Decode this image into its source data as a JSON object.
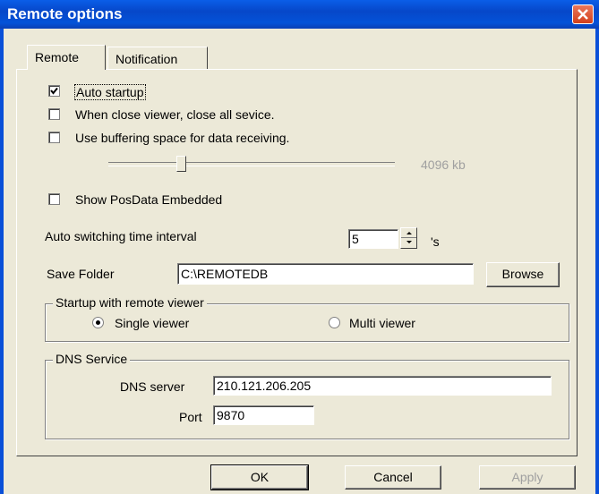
{
  "window": {
    "title": "Remote options"
  },
  "tabs": [
    {
      "label": "Remote"
    },
    {
      "label": "Notification"
    }
  ],
  "options": {
    "auto_startup": {
      "label": "Auto startup",
      "checked": true
    },
    "close_all_service": {
      "label": "When close viewer, close all sevice.",
      "checked": false
    },
    "buffering": {
      "label": "Use buffering space for data receiving.",
      "checked": false
    },
    "buffer_value": "4096 kb",
    "buffer_slider_fraction": 0.27,
    "show_posdata": {
      "label": "Show PosData Embedded",
      "checked": false
    }
  },
  "auto_switch": {
    "label": "Auto switching time interval",
    "value": "5",
    "unit": "'s"
  },
  "save_folder": {
    "label": "Save Folder",
    "value": "C:\\REMOTEDB",
    "browse_label": "Browse"
  },
  "startup_group": {
    "title": "Startup with remote viewer",
    "single_label": "Single viewer",
    "multi_label": "Multi viewer",
    "selected": "Single viewer"
  },
  "dns_group": {
    "title": "DNS Service",
    "server_label": "DNS server",
    "server_value": "210.121.206.205",
    "port_label": "Port",
    "port_value": "9870"
  },
  "buttons": {
    "ok": "OK",
    "cancel": "Cancel",
    "apply": "Apply"
  },
  "colors": {
    "titlebar": "#0a50d8",
    "close": "#d4401c",
    "dialog_bg": "#ece9d8"
  }
}
